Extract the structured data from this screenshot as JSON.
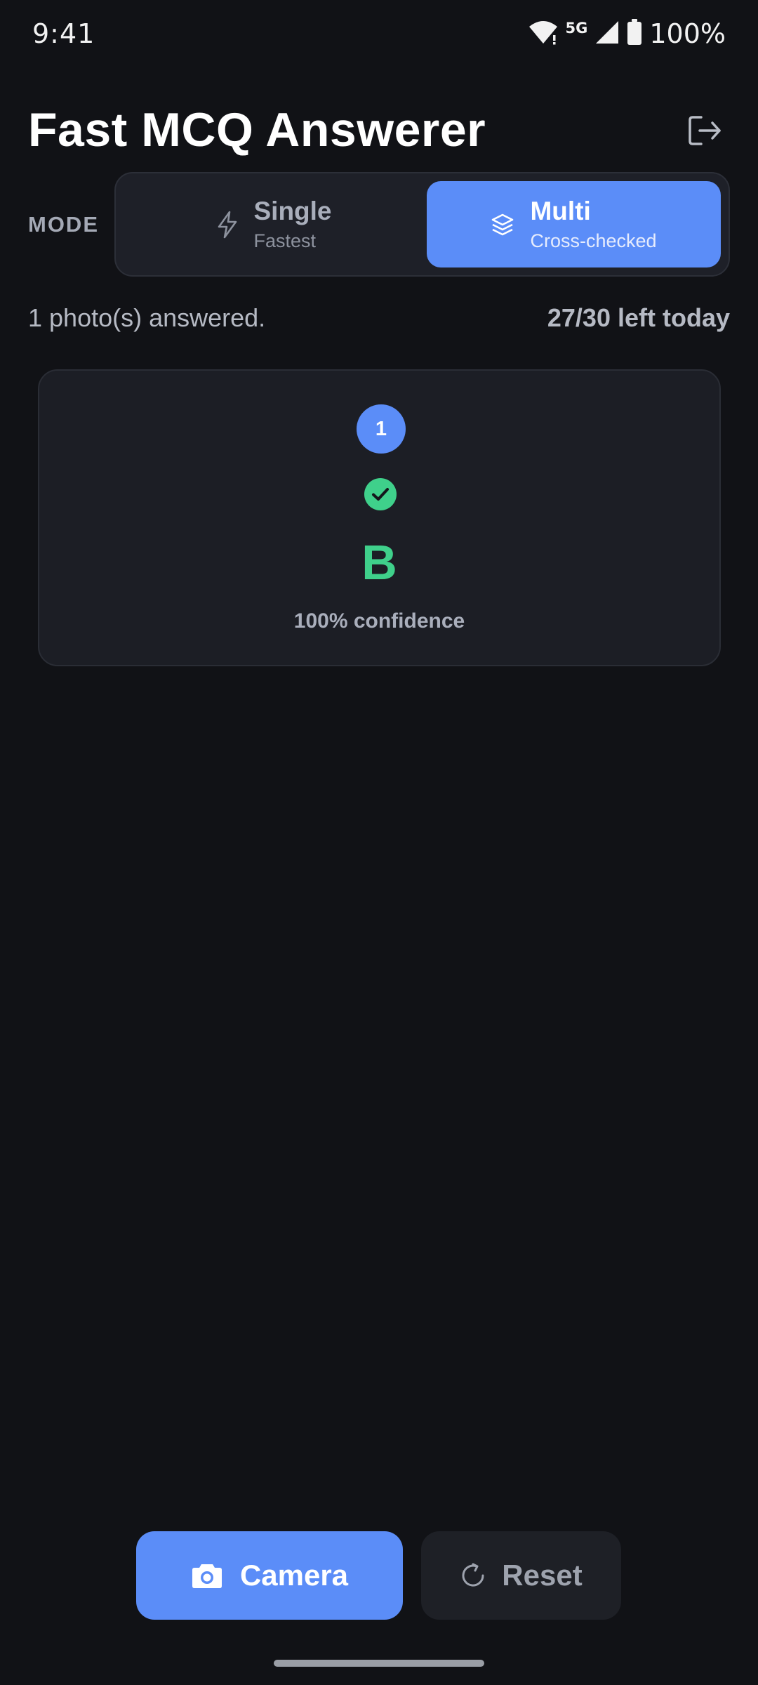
{
  "status_bar": {
    "time": "9:41",
    "network": "5G",
    "battery": "100%"
  },
  "header": {
    "title": "Fast MCQ Answerer",
    "logout_icon": "logout-icon"
  },
  "mode": {
    "label": "MODE",
    "selected": "multi",
    "options": [
      {
        "title": "Single",
        "subtitle": "Fastest",
        "icon": "lightning-icon"
      },
      {
        "title": "Multi",
        "subtitle": "Cross-checked",
        "icon": "layers-icon"
      }
    ]
  },
  "usage": {
    "answered": "1 photo(s) answered.",
    "quota": "27/30 left today"
  },
  "results": [
    {
      "index": "1",
      "status_icon": "check-circle-icon",
      "answer": "B",
      "confidence": "100% confidence"
    }
  ],
  "actions": {
    "camera_label": "Camera",
    "reset_label": "Reset"
  },
  "colors": {
    "background": "#111216",
    "accent": "#5b8df8",
    "success": "#3fd08b",
    "surface": "#1c1e25"
  }
}
